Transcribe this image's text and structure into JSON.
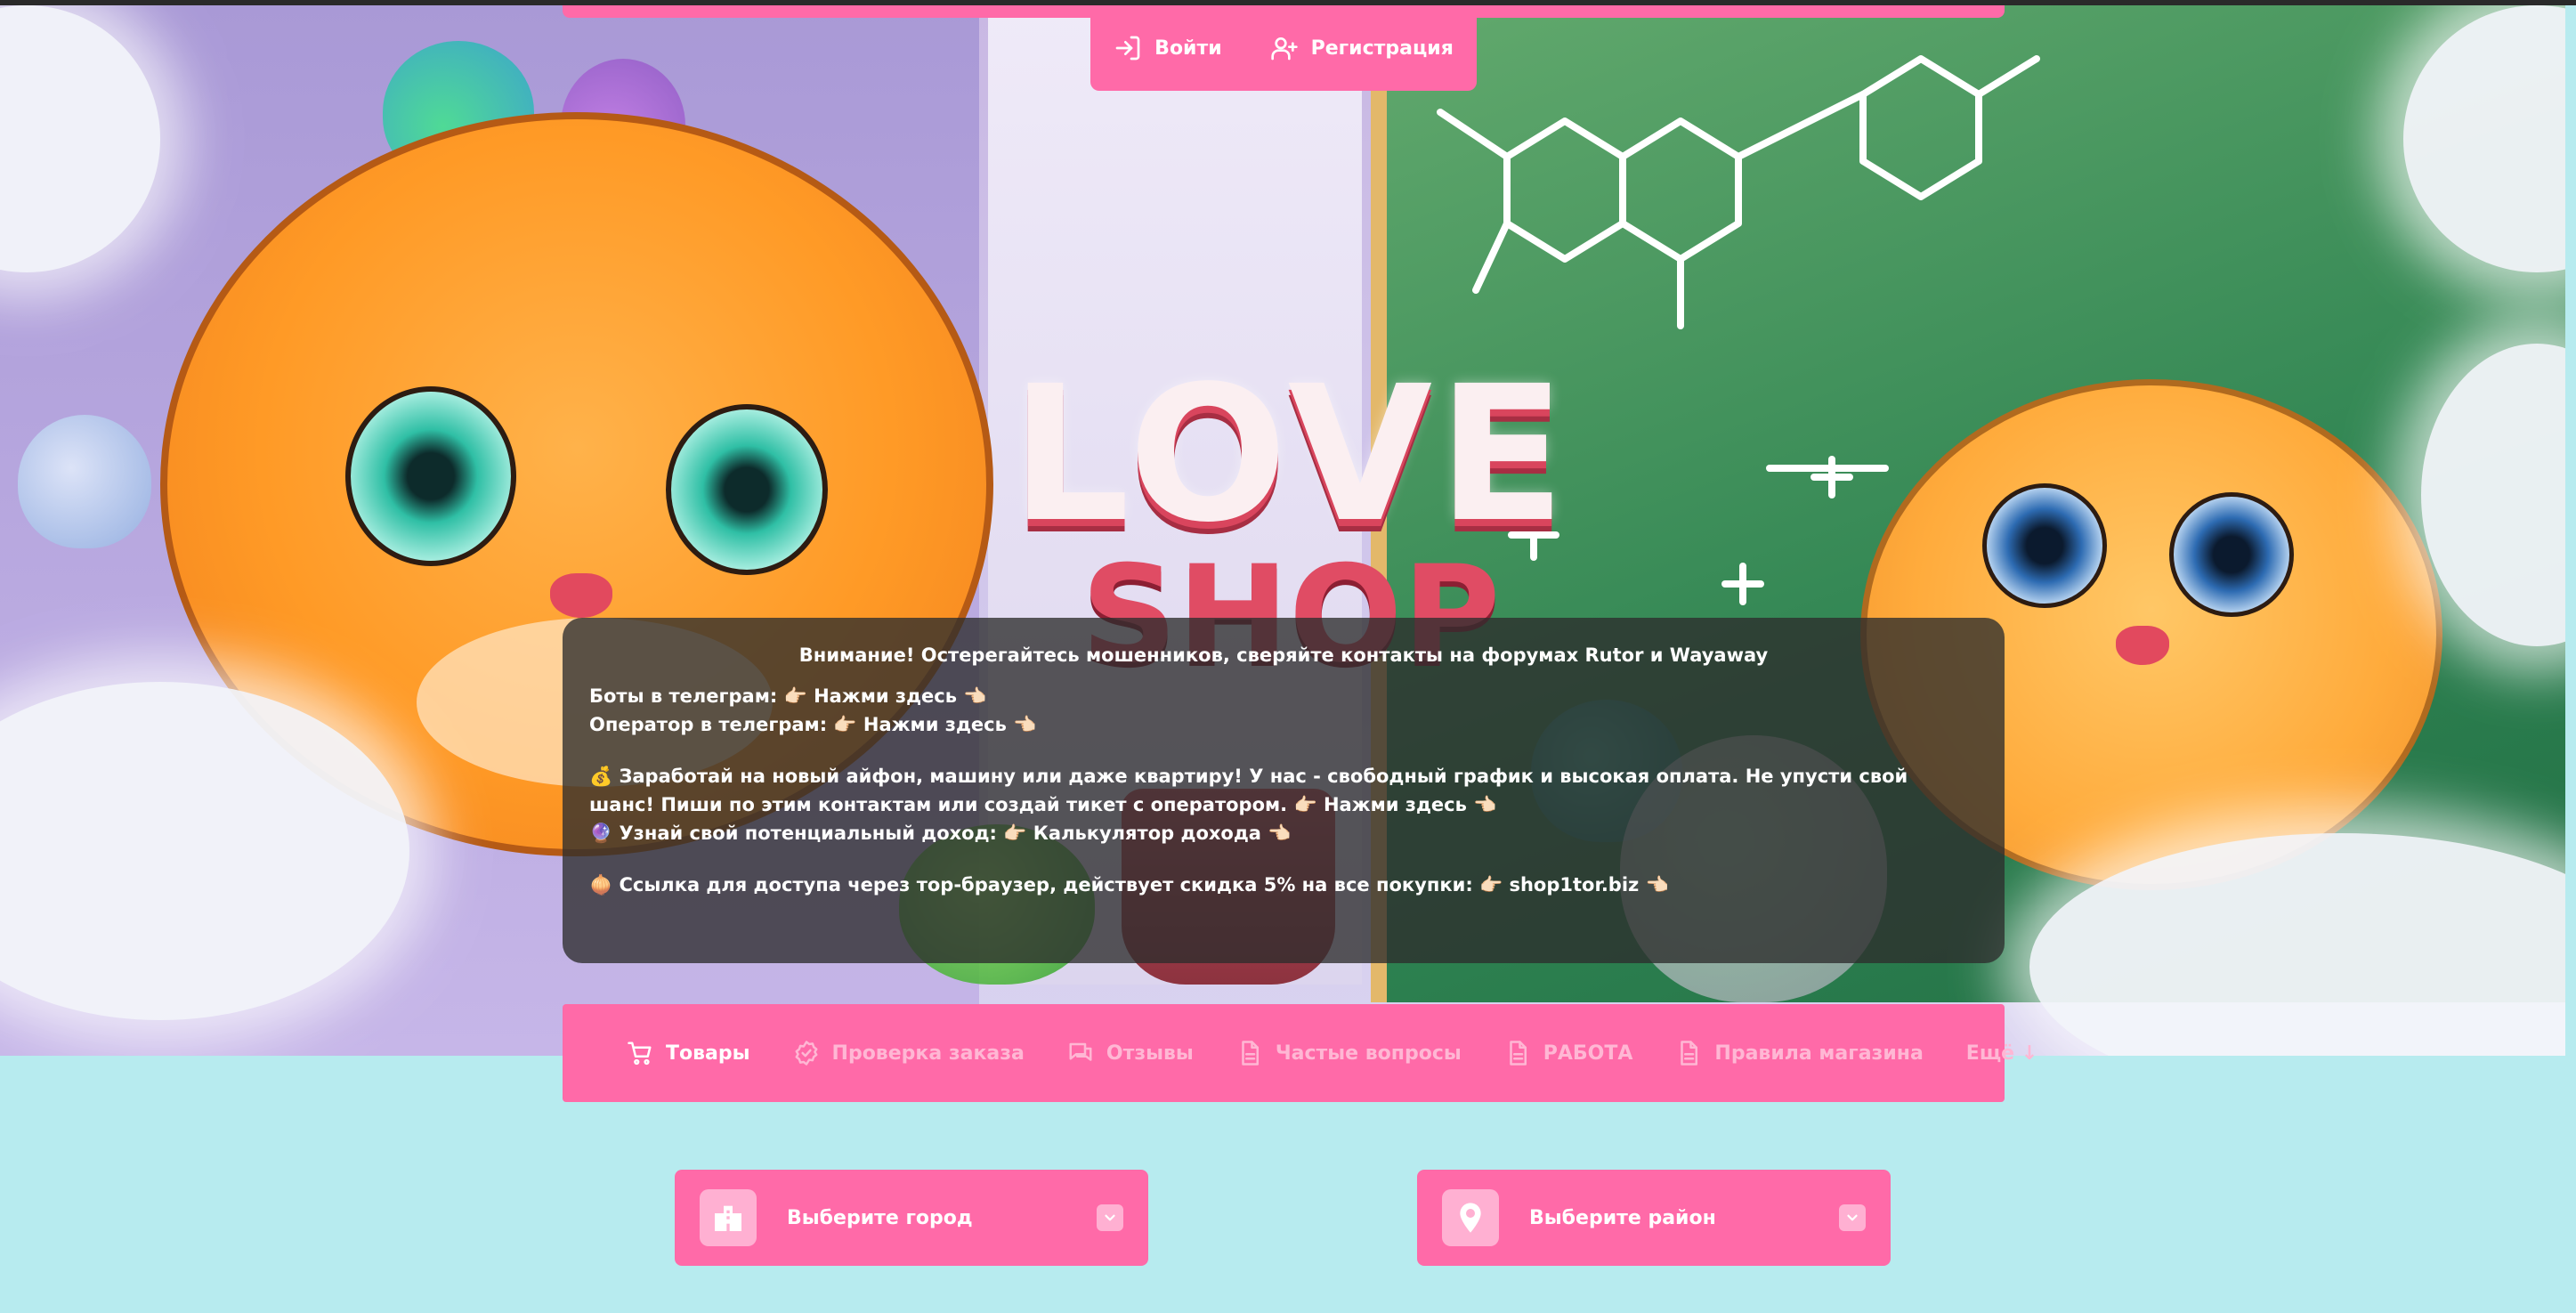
{
  "auth": {
    "login_label": "Войти",
    "register_label": "Регистрация"
  },
  "logo": {
    "line1": "LOVE",
    "line2": "SHOP"
  },
  "notice": {
    "title": "Внимание! Остерегайтесь мошенников, сверяйте контакты на форумах Rutor и Wayaway",
    "bots_label": "Боты в телеграм: 👉🏻 ",
    "bots_link": "Нажми здесь",
    "operator_label": "Оператор в телеграм: 👉🏻 ",
    "operator_link": "Нажми здесь",
    "job_text": "💰 Заработай на новый айфон, машину или даже квартиру! У нас - свободный график и высокая оплата. Не упусти свой шанс! Пиши по этим контактам или создай тикет с оператором. 👉🏻 ",
    "job_link": "Нажми здесь",
    "income_label": "🔮 Узнай свой потенциальный доход: 👉🏻 ",
    "income_link": "Калькулятор дохода",
    "tor_label": "🧅 Ссылка для доступа через тор-браузер, действует скидка 5% на все покупки: 👉🏻 ",
    "tor_link": "shop1tor.biz",
    "pointer_back": " 👈🏻"
  },
  "nav": {
    "items": [
      {
        "label": "Товары",
        "icon": "cart-icon"
      },
      {
        "label": "Проверка заказа",
        "icon": "badge-check-icon"
      },
      {
        "label": "Отзывы",
        "icon": "chat-icon"
      },
      {
        "label": "Частые вопросы",
        "icon": "document-icon"
      },
      {
        "label": "РАБОТА",
        "icon": "document-icon"
      },
      {
        "label": "Правила магазина",
        "icon": "document-icon"
      },
      {
        "label": "Ещё ↓",
        "icon": ""
      }
    ]
  },
  "selectors": {
    "city": {
      "label": "Выберите город",
      "icon": "buildings-icon"
    },
    "district": {
      "label": "Выберите район",
      "icon": "map-pin-icon"
    }
  },
  "colors": {
    "accent": "#ff6aa8",
    "accent_light": "#ffb0d2",
    "page_bg": "#b7ebef",
    "notice_bg": "#2d2d2dc7"
  }
}
